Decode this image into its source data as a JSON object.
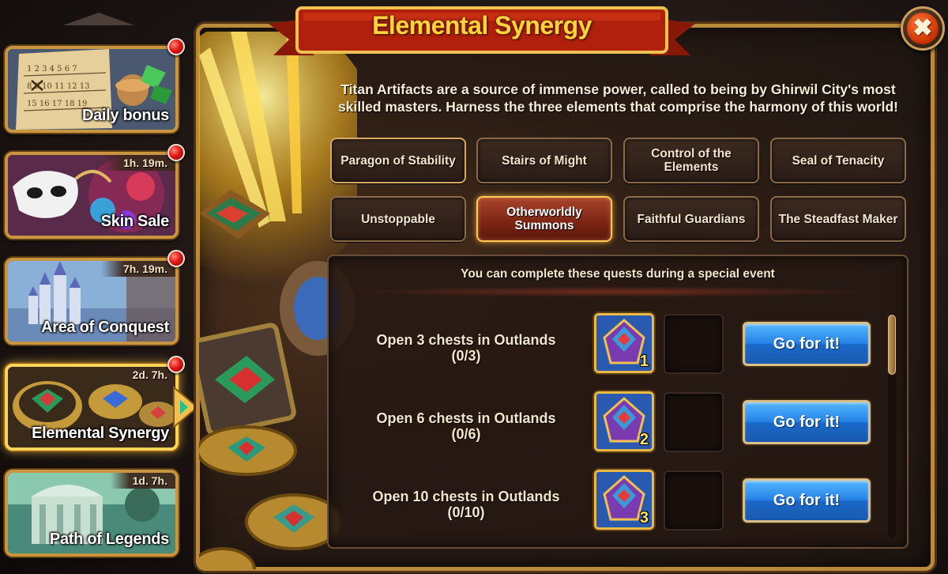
{
  "title": "Elemental Synergy",
  "description": "Titan Artifacts are a source of immense power, called to being by Ghirwil City's most skilled masters. Harness the three elements that comprise the harmony of this world!",
  "close_icon_glyph": "✖",
  "sidebar": {
    "items": [
      {
        "label": "Daily bonus",
        "timer": "",
        "icon": "calendar-icon",
        "notification": true
      },
      {
        "label": "Skin Sale",
        "timer": "1h. 19m.",
        "icon": "mask-icon",
        "notification": true
      },
      {
        "label": "Area of Conquest",
        "timer": "7h. 19m.",
        "icon": "castle-icon",
        "notification": true
      },
      {
        "label": "Elemental Synergy",
        "timer": "2d. 7h.",
        "icon": "artifact-coins-icon",
        "notification": true,
        "active": true
      },
      {
        "label": "Path of Legends",
        "timer": "1d. 7h.",
        "icon": "temple-icon",
        "notification": false
      }
    ]
  },
  "tabs": [
    {
      "label": "Paragon of Stability",
      "selected": false
    },
    {
      "label": "Stairs of Might",
      "selected": false
    },
    {
      "label": "Control of the Elements",
      "selected": false
    },
    {
      "label": "Seal of Tenacity",
      "selected": false
    },
    {
      "label": "Unstoppable",
      "selected": false
    },
    {
      "label": "Otherworldly Summons",
      "selected": true
    },
    {
      "label": "Faithful Guardians",
      "selected": false
    },
    {
      "label": "The Steadfast Maker",
      "selected": false
    }
  ],
  "quests": {
    "header": "You can complete these quests during a special event",
    "items": [
      {
        "title": "Open 3 chests in Outlands",
        "progress": "(0/3)",
        "reward_icon": "artifact-chest-icon",
        "reward_qty": "1",
        "button": "Go for it!"
      },
      {
        "title": "Open 6 chests in Outlands",
        "progress": "(0/6)",
        "reward_icon": "artifact-chest-icon",
        "reward_qty": "2",
        "button": "Go for it!"
      },
      {
        "title": "Open 10 chests in Outlands",
        "progress": "(0/10)",
        "reward_icon": "artifact-chest-icon",
        "reward_qty": "3",
        "button": "Go for it!"
      }
    ]
  },
  "colors": {
    "title_gold": "#ffd43a",
    "banner_red": "#b0200c",
    "panel_border": "#b98a3a",
    "selected_tab": "#a8442a",
    "go_button_blue": "#2683e6",
    "notification_red": "#e01818"
  }
}
